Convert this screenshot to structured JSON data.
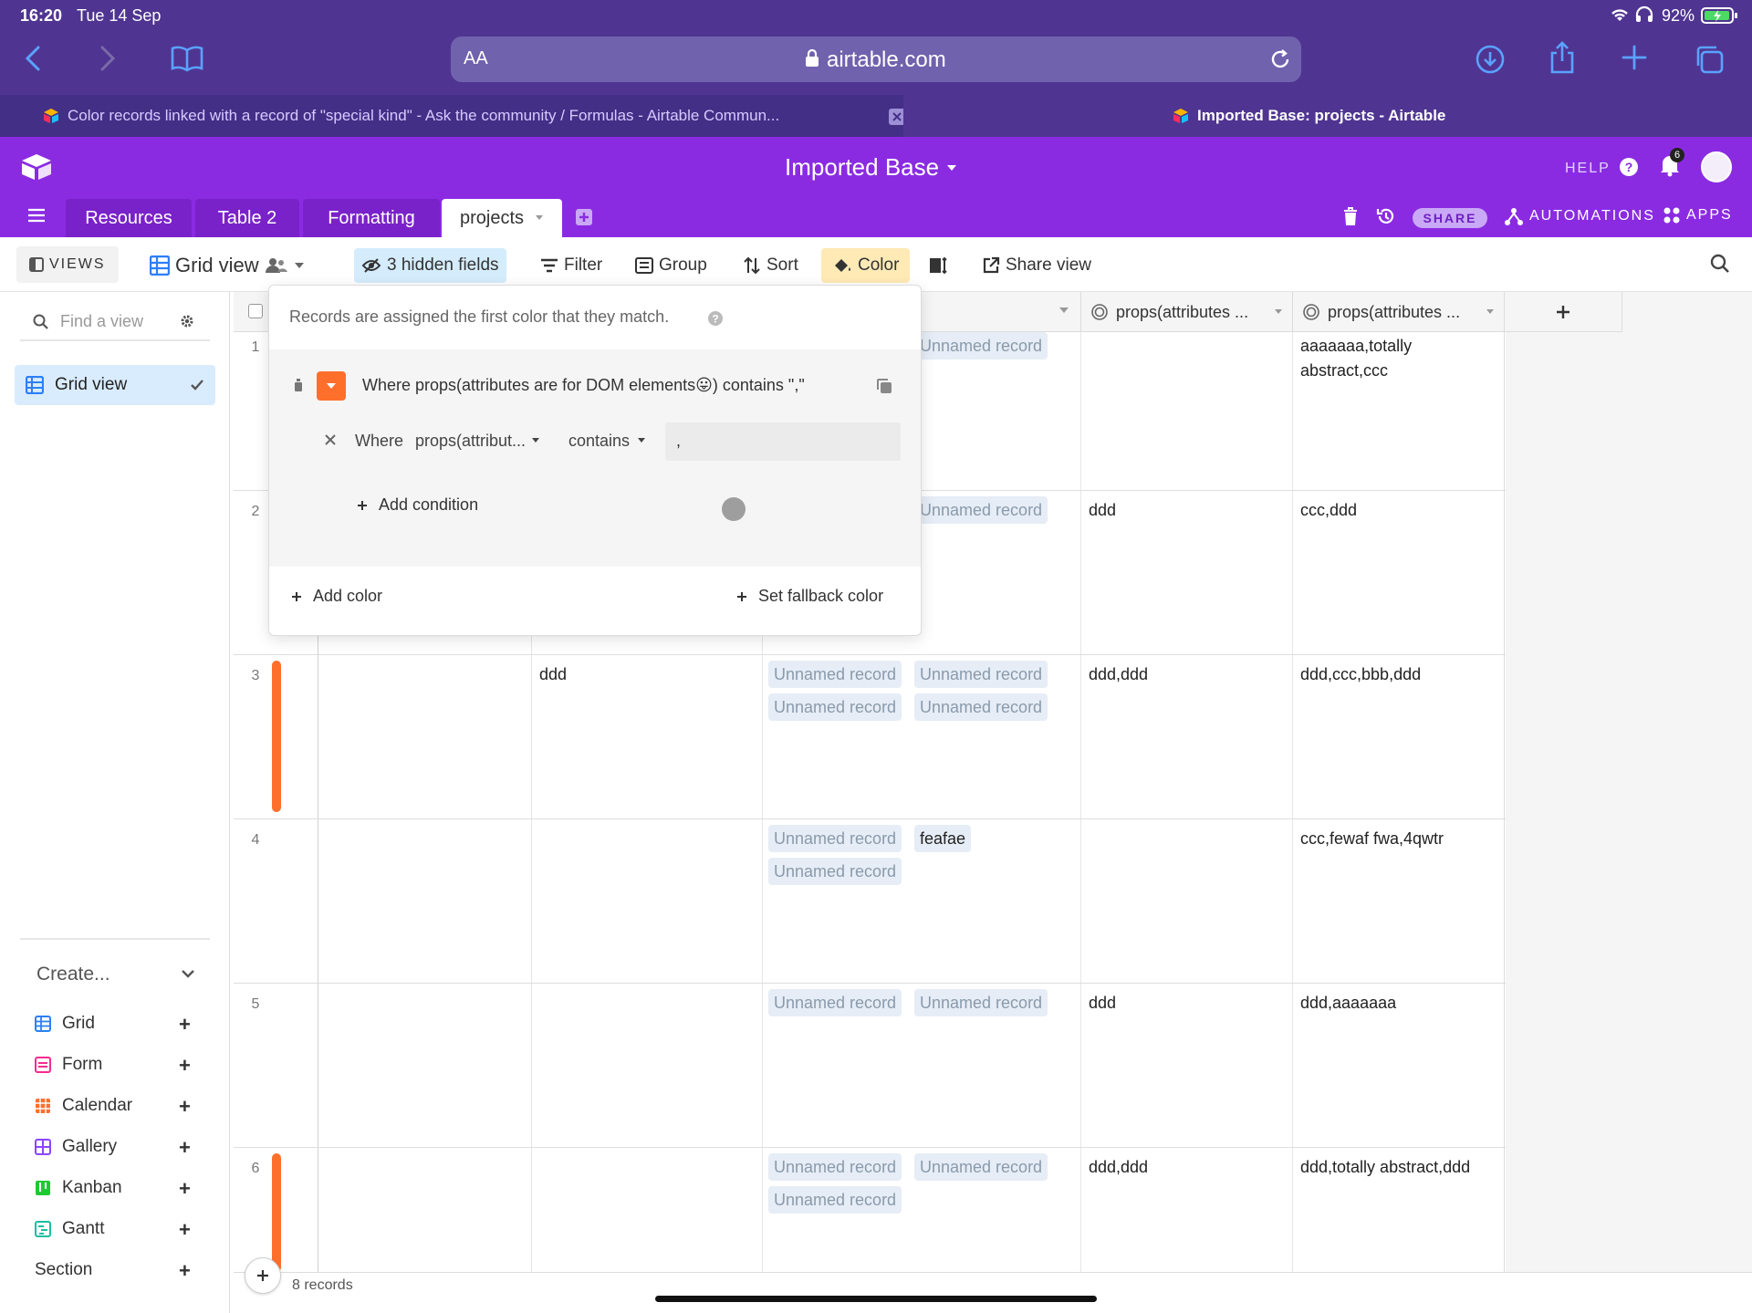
{
  "status_bar": {
    "time": "16:20",
    "date": "Tue 14 Sep",
    "battery": "92%"
  },
  "safari": {
    "text_size": "AA",
    "url": "airtable.com"
  },
  "browser_tabs": [
    {
      "title": "Color records linked with a record of \"special kind\" - Ask the community / Formulas - Airtable Commun..."
    },
    {
      "title": "Imported Base: projects - Airtable"
    }
  ],
  "base": {
    "name": "Imported Base",
    "help": "HELP",
    "notifications": "6"
  },
  "tables": [
    "Resources",
    "Table 2",
    "Formatting",
    "projects"
  ],
  "header_actions": {
    "share": "SHARE",
    "automations": "AUTOMATIONS",
    "apps": "APPS"
  },
  "toolbar": {
    "views": "VIEWS",
    "view_name": "Grid view",
    "hidden_fields": "3 hidden fields",
    "filter": "Filter",
    "group": "Group",
    "sort": "Sort",
    "color": "Color",
    "share_view": "Share view"
  },
  "sidebar": {
    "find_placeholder": "Find a view",
    "views": [
      {
        "label": "Grid view"
      }
    ],
    "create_label": "Create...",
    "create_items": [
      {
        "label": "Grid",
        "color": "#2d7ff9"
      },
      {
        "label": "Form",
        "color": "#f82b90"
      },
      {
        "label": "Calendar",
        "color": "#ff6f2c"
      },
      {
        "label": "Gallery",
        "color": "#8b46ff"
      },
      {
        "label": "Kanban",
        "color": "#20c933"
      },
      {
        "label": "Gantt",
        "color": "#18bfa0"
      },
      {
        "label": "Section",
        "color": ""
      }
    ]
  },
  "color_popover": {
    "intro": "Records are assigned the first color that they match.",
    "rule_summary": "Where props(attributes are for DOM elements😛) contains \",\"",
    "condition": {
      "where": "Where",
      "field": "props(attribut...",
      "operator": "contains",
      "value": ","
    },
    "add_condition": "Add condition",
    "add_color": "Add color",
    "set_fallback": "Set fallback color",
    "rule_color": "#ff6f2c"
  },
  "grid": {
    "columns": [
      {
        "name": "props(attributes ..."
      },
      {
        "name": "props(attributes ..."
      }
    ],
    "rows": [
      {
        "num": "1",
        "colored": false,
        "text_col": "",
        "links": [
          "Unnamed record"
        ],
        "col_a": "",
        "col_b": "aaaaaaa,totally abstract,ccc"
      },
      {
        "num": "2",
        "colored": false,
        "text_col": "",
        "links": [
          "Unnamed record"
        ],
        "col_a": "ddd",
        "col_b": "ccc,ddd"
      },
      {
        "num": "3",
        "colored": true,
        "text_col": "ddd",
        "links": [
          "Unnamed record",
          "Unnamed record",
          "Unnamed record",
          "Unnamed record"
        ],
        "col_a": "ddd,ddd",
        "col_b": "ddd,ccc,bbb,ddd"
      },
      {
        "num": "4",
        "colored": false,
        "text_col": "",
        "links": [
          "Unnamed record",
          "feafae",
          "Unnamed record"
        ],
        "col_a": "",
        "col_b": "ccc,fewaf fwa,4qwtr"
      },
      {
        "num": "5",
        "colored": false,
        "text_col": "",
        "links": [
          "Unnamed record",
          "Unnamed record"
        ],
        "col_a": "ddd",
        "col_b": "ddd,aaaaaaa"
      },
      {
        "num": "6",
        "colored": true,
        "text_col": "",
        "links": [
          "Unnamed record",
          "Unnamed record",
          "Unnamed record"
        ],
        "col_a": "ddd,ddd",
        "col_b": "ddd,totally abstract,ddd"
      }
    ],
    "record_count": "8 records"
  }
}
